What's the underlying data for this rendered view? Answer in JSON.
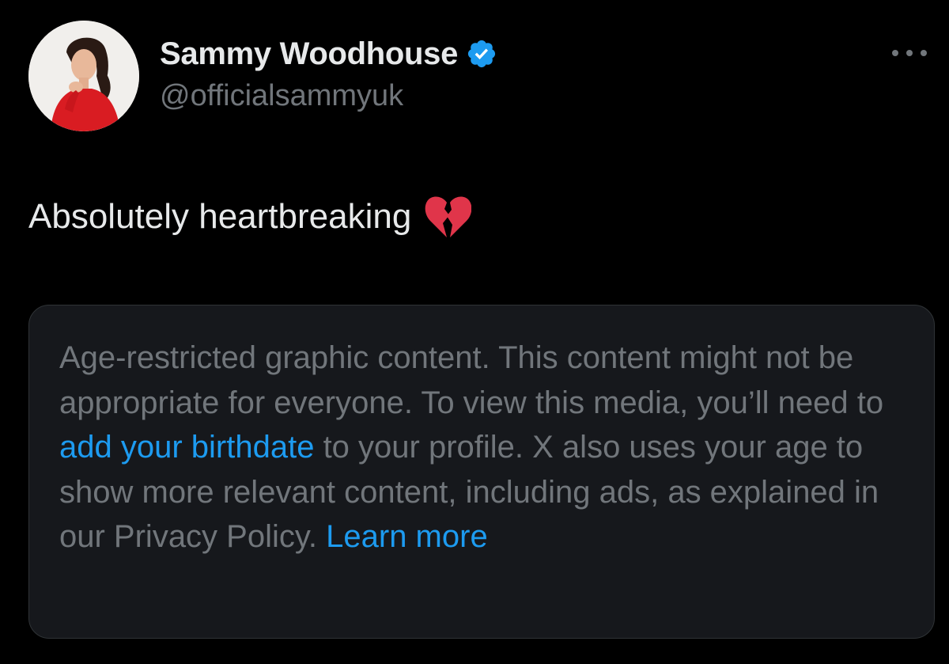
{
  "author": {
    "display_name": "Sammy Woodhouse",
    "handle": "@officialsammyuk",
    "verified": true,
    "avatar_icon": "profile-photo"
  },
  "more_icon": "ellipsis-icon",
  "tweet": {
    "text": "Absolutely heartbreaking",
    "emoji": "broken-heart-icon"
  },
  "media_notice": {
    "text_before_link": "Age-restricted graphic content. This content might not be appropriate for everyone. To view this media, you’ll need to ",
    "birthdate_link": "add your birthdate",
    "text_after_link": " to your profile. X also uses your age to show more relevant content, including ads, as explained in our Privacy Policy. ",
    "learn_more_link": "Learn more"
  },
  "colors": {
    "background": "#000000",
    "primary_text": "#e7e9ea",
    "secondary_text": "#71767b",
    "link": "#1d9bf0",
    "verified_badge": "#1d9bf0",
    "card_background": "#16181c",
    "card_border": "#2f3336"
  }
}
